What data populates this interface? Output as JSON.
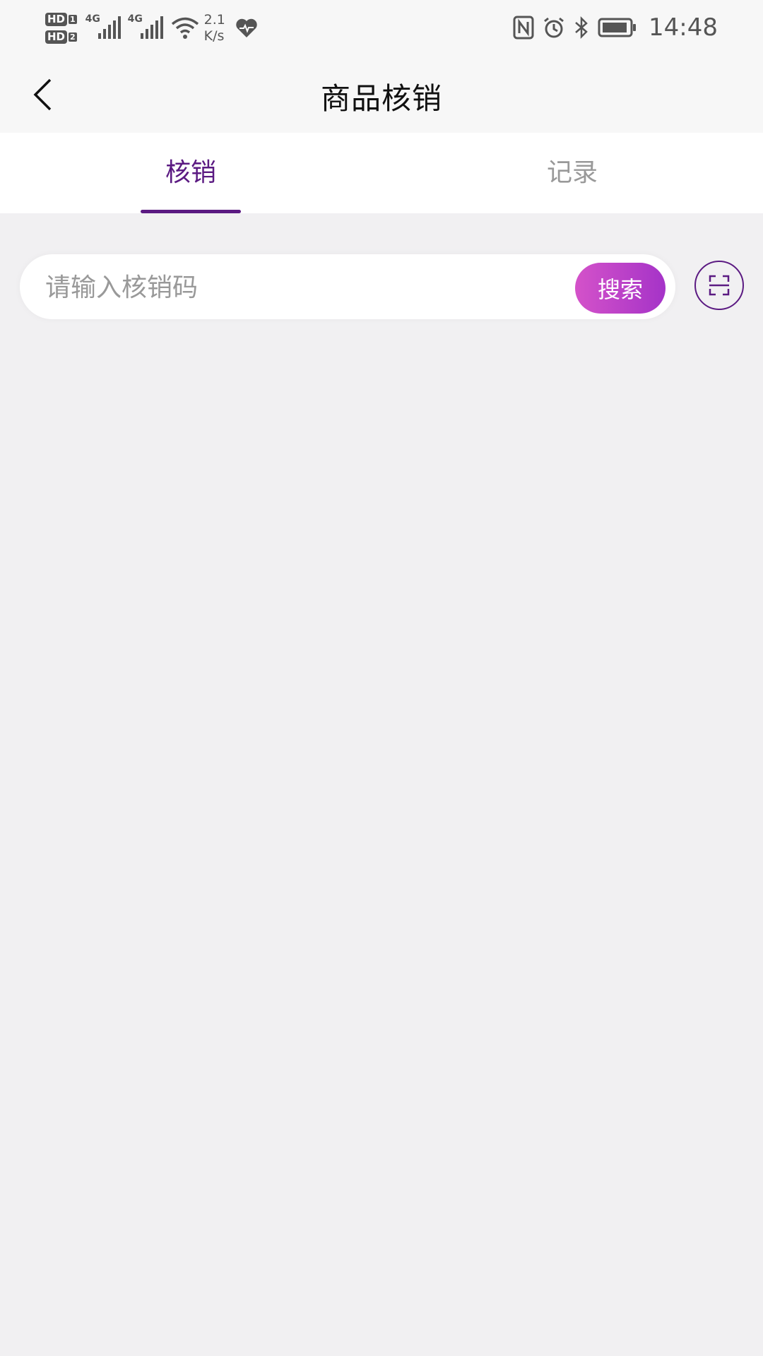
{
  "status_bar": {
    "network_speed_value": "2.1",
    "network_speed_unit": "K/s",
    "time": "14:48",
    "hd1": "HD",
    "hd1_num": "1",
    "hd2": "HD",
    "hd2_num": "2",
    "signal1": "4G",
    "signal2": "4G",
    "icons": [
      "hd-icon",
      "signal-4g-icon",
      "signal-4g-icon",
      "wifi-icon",
      "health-heart-icon",
      "nfc-icon",
      "alarm-icon",
      "bluetooth-icon",
      "battery-icon"
    ]
  },
  "header": {
    "title": "商品核销",
    "back_icon": "chevron-left-icon"
  },
  "tabs": [
    {
      "label": "核销",
      "active": true
    },
    {
      "label": "记录",
      "active": false
    }
  ],
  "search": {
    "placeholder": "请输入核销码",
    "value": "",
    "button_label": "搜索",
    "scan_icon": "scan-icon"
  },
  "colors": {
    "accent": "#5b1a82",
    "button_gradient_start": "#d452c9",
    "button_gradient_end": "#a533c8",
    "background": "#f1f0f2"
  }
}
